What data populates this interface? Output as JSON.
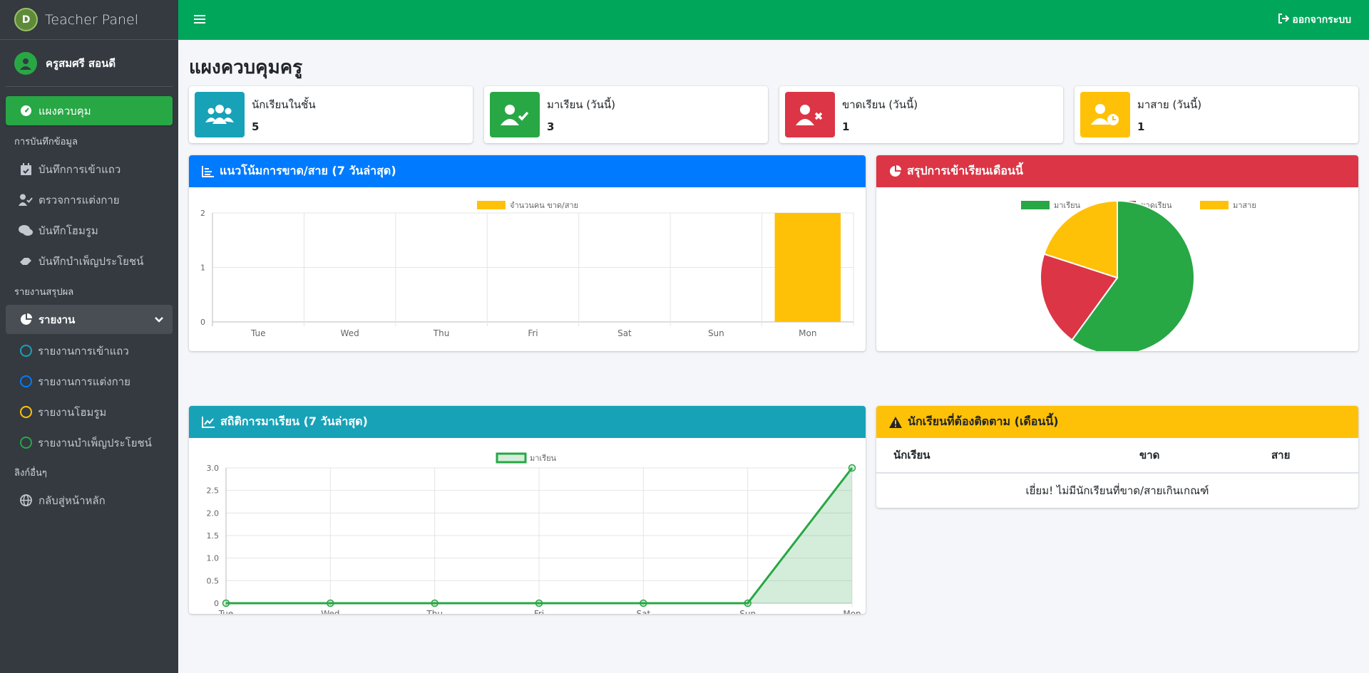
{
  "brand": {
    "title": "Teacher Panel",
    "logo_text": "D"
  },
  "user": {
    "name": "ครูสมศรี สอนดี"
  },
  "sidebar": {
    "dashboard": "แผงควบคุม",
    "header_record": "การบันทึกข้อมูล",
    "record_items": [
      "บันทึกการเข้าแถว",
      "ตรวจการแต่งกาย",
      "บันทึกโฮมรูม",
      "บันทึกบำเพ็ญประโยชน์"
    ],
    "header_report": "รายงานสรุปผล",
    "report": "รายงาน",
    "report_items": [
      {
        "label": "รายงานการเข้าแถว",
        "color": "#17a2b8"
      },
      {
        "label": "รายงานการแต่งกาย",
        "color": "#007bff"
      },
      {
        "label": "รายงานโฮมรูม",
        "color": "#ffc107"
      },
      {
        "label": "รายงานบำเพ็ญประโยชน์",
        "color": "#28a745"
      }
    ],
    "header_links": "ลิงก์อื่นๆ",
    "home": "กลับสู่หน้าหลัก"
  },
  "topbar": {
    "logout": "ออกจากระบบ"
  },
  "page": {
    "title": "แผงควบคุมครู"
  },
  "stats": [
    {
      "label": "นักเรียนในชั้น",
      "value": "5",
      "color": "#17a2b8",
      "icon": "users-icon"
    },
    {
      "label": "มาเรียน (วันนี้)",
      "value": "3",
      "color": "#28a745",
      "icon": "user-check-icon"
    },
    {
      "label": "ขาดเรียน (วันนี้)",
      "value": "1",
      "color": "#dc3545",
      "icon": "user-times-icon"
    },
    {
      "label": "มาสาย (วันนี้)",
      "value": "1",
      "color": "#ffc107",
      "icon": "user-clock-icon"
    }
  ],
  "cards": {
    "absent_trend": "แนวโน้มการขาด/สาย (7 วันล่าสุด)",
    "monthly_summary": "สรุปการเข้าเรียนเดือนนี้",
    "attendance_stats": "สถิติการมาเรียน (7 วันล่าสุด)",
    "follow_up": "นักเรียนที่ต้องติดตาม (เดือนนี้)"
  },
  "follow_table": {
    "headers": [
      "นักเรียน",
      "ขาด",
      "สาย"
    ],
    "empty": "เยี่ยม! ไม่มีนักเรียนที่ขาด/สายเกินเกณฑ์"
  },
  "chart_data": [
    {
      "type": "bar",
      "categories": [
        "Tue",
        "Wed",
        "Thu",
        "Fri",
        "Sat",
        "Sun",
        "Mon"
      ],
      "series": [
        {
          "name": "จำนวนคน ขาด/สาย",
          "values": [
            0,
            0,
            0,
            0,
            0,
            0,
            2
          ],
          "color": "#ffc107"
        }
      ],
      "ylim": [
        0,
        2
      ],
      "yticks": [
        "0",
        "1",
        "2"
      ],
      "grid": true,
      "legend": "top"
    },
    {
      "type": "pie",
      "labels": [
        "มาเรียน",
        "ขาดเรียน",
        "มาสาย"
      ],
      "values": [
        3,
        1,
        1
      ],
      "colors": [
        "#28a745",
        "#dc3545",
        "#ffc107"
      ],
      "legend": "top"
    },
    {
      "type": "area",
      "categories": [
        "Tue",
        "Wed",
        "Thu",
        "Fri",
        "Sat",
        "Sun",
        "Mon"
      ],
      "series": [
        {
          "name": "มาเรียน",
          "values": [
            0,
            0,
            0,
            0,
            0,
            0,
            3
          ],
          "color": "#28a745"
        }
      ],
      "ylim": [
        0,
        3
      ],
      "yticks": [
        "0",
        "0.5",
        "1.0",
        "1.5",
        "2.0",
        "2.5",
        "3.0"
      ],
      "grid": true,
      "legend": "top"
    }
  ]
}
